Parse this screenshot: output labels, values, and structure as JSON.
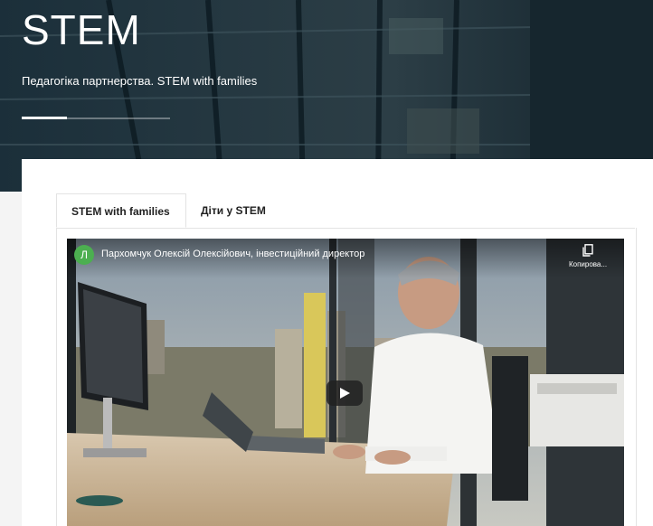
{
  "hero": {
    "title": "STEM",
    "subtitle": "Педагогіка партнерства. STEM with families"
  },
  "tabs": [
    {
      "label": "STEM with families",
      "active": true
    },
    {
      "label": "Діти у STEM",
      "active": false
    }
  ],
  "video": {
    "channel_initial": "Л",
    "title": "Пархомчук Олексій Олексійович, інвестиційний директор",
    "copy_label": "Копирова...",
    "icons": [
      "copy-icon",
      "play-icon"
    ]
  },
  "colors": {
    "hero_bg": "#0d1f29",
    "avatar": "#4caf50",
    "tab_border": "#e3e3e3"
  }
}
